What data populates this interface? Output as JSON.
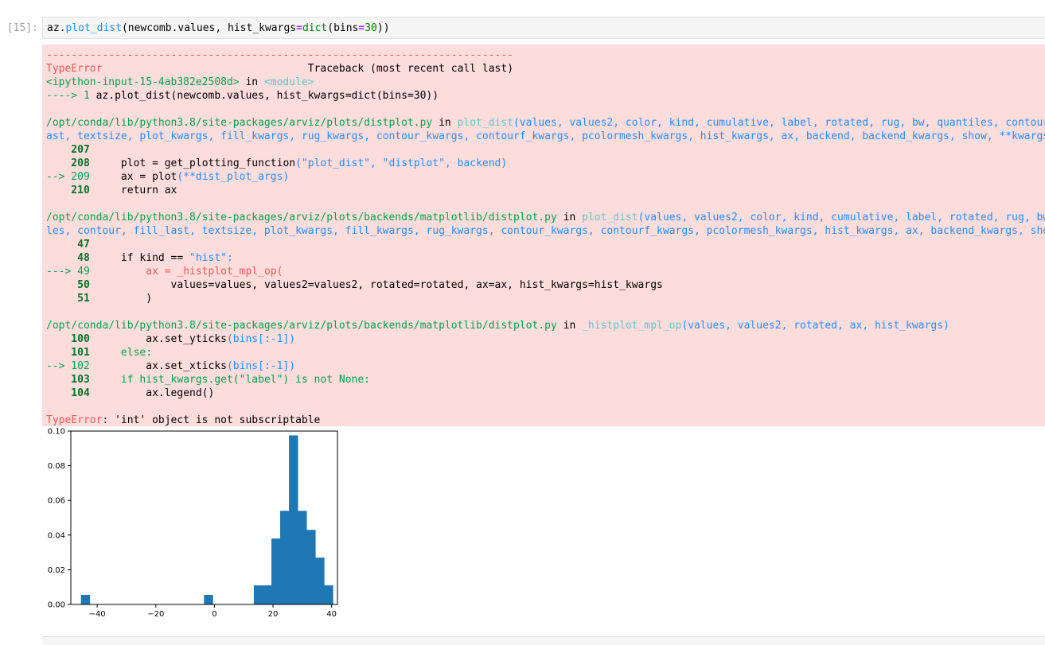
{
  "cell": {
    "prompt": "[15]:",
    "code": [
      "az",
      ".",
      "plot_dist",
      "(",
      "newcomb",
      ".",
      "values",
      ",",
      " hist_kwargs",
      "=",
      "dict",
      "(",
      "bins",
      "=",
      "30",
      "))"
    ]
  },
  "traceback": {
    "dashes": "---------------------------------------------------------------------------",
    "error_name": "TypeError",
    "header_right": "Traceback (most recent call last)",
    "l1_a": "<ipython-input-15-4ab382e2508d>",
    "l1_b": " in ",
    "l1_c": "<module>",
    "l2_arrow": "----> 1",
    "l2_a": " az.plot_dist(newcomb.values, hist_kwargs=dict(bins=30))",
    "f1_path": "/opt/conda/lib/python3.8/site-packages/arviz/plots/distplot.py",
    "in_word": " in ",
    "f1_func": "plot_dist",
    "f1_args1": "(values, values2, color, kind, cumulative, label, rotated, rug, bw, quantiles, contour, fill_l",
    "f1_args2": "ast, textsize, plot_kwargs, fill_kwargs, rug_kwargs, contour_kwargs, contourf_kwargs, pcolormesh_kwargs, hist_kwargs, ax, backend, backend_kwargs, show, **kwargs)",
    "f1_207": "    207",
    "f1_208": "    208",
    "f1_208_code_a": "     plot ",
    "f1_208_code_b": "=",
    "f1_208_code_c": " get_plotting_function",
    "f1_208_code_d": "(\"plot_dist\", \"distplot\", backend)",
    "f1_209_arrow": "--> 209",
    "f1_209_code_a": "     ax ",
    "f1_209_code_b": "=",
    "f1_209_code_c": " plot",
    "f1_209_code_d": "(**dist_plot_args)",
    "f1_210": "    210",
    "f1_210_code": "     return ax",
    "f2_path": "/opt/conda/lib/python3.8/site-packages/arviz/plots/backends/matplotlib/distplot.py",
    "f2_func": "plot_dist",
    "f2_args1": "(values, values2, color, kind, cumulative, label, rotated, rug, bw, quantiles, contour, fill_last",
    "f2_args2": "les, contour, fill_last, textsize, plot_kwargs, fill_kwargs, rug_kwargs, contour_kwargs, contourf_kwargs, pcolormesh_kwargs, hist_kwargs, ax, backend_kwargs, show)",
    "f2_47": "     47",
    "f2_48": "     48",
    "f2_48_code_a": "     if kind ",
    "f2_48_code_b": "==",
    "f2_48_code_c": " \"hist\":",
    "f2_49_arrow": "---> 49",
    "f2_49_code": "         ax = _histplot_mpl_op(",
    "f2_50": "     50",
    "f2_50_code": "             values=values, values2=values2, rotated=rotated, ax=ax, hist_kwargs=hist_kwargs",
    "f2_51": "     51",
    "f2_51_code": "         )",
    "f3_path": "/opt/conda/lib/python3.8/site-packages/arviz/plots/backends/matplotlib/distplot.py",
    "f3_func": "_histplot_mpl_op",
    "f3_args": "(values, values2, rotated, ax, hist_kwargs)",
    "f3_100": "    100",
    "f3_100_code_a": "         ax.set_yticks",
    "f3_100_code_b": "(bins[:-1])",
    "f3_101": "    101",
    "f3_101_code": "     else:",
    "f3_102_arrow": "--> 102",
    "f3_102_code_a": "         ax.set_xticks",
    "f3_102_code_b": "(bins[:-1])",
    "f3_103": "    103",
    "f3_103_code_a": "     if hist_kwargs.get(\"label\") is not None:",
    "f3_104": "    104",
    "f3_104_code": "         ax.legend()",
    "final_msg": ": 'int' object is not subscriptable"
  },
  "colors": {
    "bar": "#1f77b4",
    "error_bg": "#fddcdc"
  },
  "chart_data": {
    "type": "bar",
    "bar_width": 3.1,
    "xlim": [
      -49,
      42
    ],
    "ylim": [
      0,
      0.1
    ],
    "xticks": [
      -40,
      -20,
      0,
      20,
      40
    ],
    "xtick_labels": [
      "−40",
      "−20",
      "0",
      "20",
      "40"
    ],
    "yticks": [
      0.0,
      0.02,
      0.04,
      0.06,
      0.08,
      0.1
    ],
    "ytick_labels": [
      "0.00",
      "0.02",
      "0.04",
      "0.06",
      "0.08",
      "0.10"
    ],
    "bars": [
      {
        "x": -44,
        "y": 0.0055
      },
      {
        "x": -2,
        "y": 0.0055
      },
      {
        "x": 15,
        "y": 0.011
      },
      {
        "x": 18,
        "y": 0.011
      },
      {
        "x": 21,
        "y": 0.038
      },
      {
        "x": 24,
        "y": 0.054
      },
      {
        "x": 27,
        "y": 0.0975
      },
      {
        "x": 30,
        "y": 0.054
      },
      {
        "x": 33,
        "y": 0.043
      },
      {
        "x": 36,
        "y": 0.027
      },
      {
        "x": 39,
        "y": 0.011
      }
    ]
  }
}
